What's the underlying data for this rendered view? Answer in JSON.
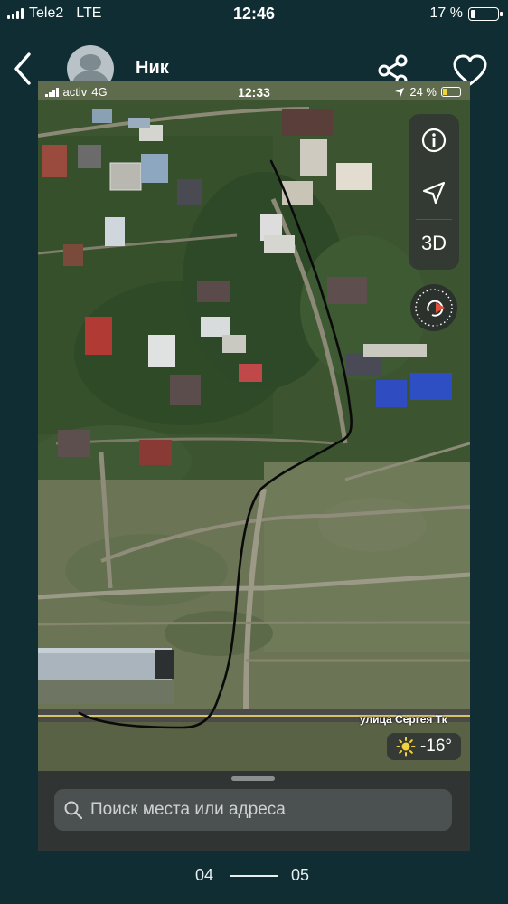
{
  "status_bar": {
    "carrier": "Tele2",
    "network": "LTE",
    "time": "12:46",
    "battery": "17 %",
    "battery_level": 0.17
  },
  "header": {
    "contact_name": "Ник",
    "back_icon": "chevron-left-icon",
    "share_icon": "share-icon",
    "like_icon": "heart-icon"
  },
  "photo": {
    "status_bar": {
      "carrier": "activ",
      "network": "4G",
      "time": "12:33",
      "battery": "24 %",
      "battery_level": 0.24
    },
    "map": {
      "controls": {
        "info_icon": "info-icon",
        "location_icon": "location-arrow-icon",
        "view_mode": "3D",
        "compass_icon": "compass-icon"
      },
      "street_label": "улица Сергея Тк",
      "weather": {
        "icon": "sun-icon",
        "temperature": "-16°"
      }
    },
    "search": {
      "placeholder": "Поиск места или адреса",
      "icon": "search-icon"
    }
  },
  "pager": {
    "current": "04",
    "next": "05"
  }
}
